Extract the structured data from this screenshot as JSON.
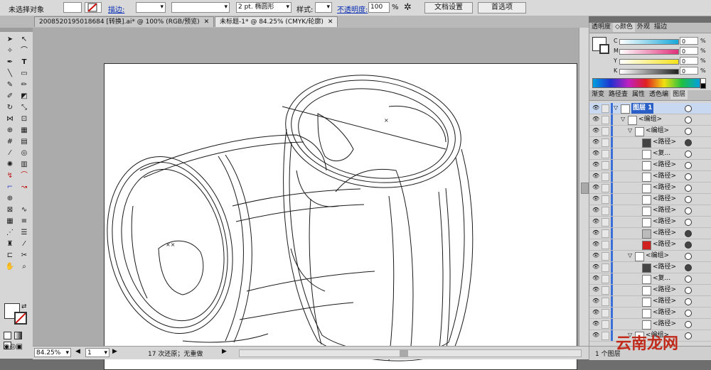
{
  "control_bar": {
    "selection_label": "未选择对象",
    "stroke_link": "描边:",
    "stroke_weight": "",
    "brush_value": "2 pt. 椭圆形",
    "style_label": "样式:",
    "opacity_link": "不透明度:",
    "opacity_value": "100",
    "opacity_unit": "%",
    "doc_setup_button": "文档设置",
    "prefs_button": "首选项"
  },
  "tabs": [
    {
      "label": "2008520195018684 [转换].ai* @ 100% (RGB/预览)",
      "active": false
    },
    {
      "label": "未标题-1* @ 84.25% (CMYK/轮廓)",
      "active": true
    }
  ],
  "status_bar": {
    "zoom": "84.25%",
    "page": "1",
    "history": "17 次还原；无重做"
  },
  "color_panel": {
    "tabs": [
      "透明度",
      "颜色",
      "外观",
      "描边"
    ],
    "active_tab": "颜色",
    "channels": [
      {
        "label": "C",
        "value": "0",
        "unit": "%",
        "color": "#19a7d9"
      },
      {
        "label": "M",
        "value": "0",
        "unit": "%",
        "color": "#e0307a"
      },
      {
        "label": "Y",
        "value": "0",
        "unit": "%",
        "color": "#f4e21c"
      },
      {
        "label": "K",
        "value": "0",
        "unit": "%",
        "color": "#222222"
      }
    ]
  },
  "layers_panel": {
    "tabs": [
      "渐变",
      "路径查",
      "属性",
      "透色编",
      "图层"
    ],
    "active_tab": "图层",
    "rows": [
      {
        "label": "图层 1",
        "indent": 0,
        "selected": true,
        "thumb": "layer"
      },
      {
        "label": "<编组>",
        "indent": 1,
        "selected": false,
        "thumb": "group"
      },
      {
        "label": "<编组>",
        "indent": 2,
        "selected": false,
        "thumb": "group"
      },
      {
        "label": "<路径>",
        "indent": 3,
        "selected": false,
        "thumb": "dark"
      },
      {
        "label": "<复...",
        "indent": 3,
        "selected": false,
        "thumb": "blank"
      },
      {
        "label": "<路径>",
        "indent": 3,
        "selected": false,
        "thumb": "blank"
      },
      {
        "label": "<路径>",
        "indent": 3,
        "selected": false,
        "thumb": "line"
      },
      {
        "label": "<路径>",
        "indent": 3,
        "selected": false,
        "thumb": "blank"
      },
      {
        "label": "<路径>",
        "indent": 3,
        "selected": false,
        "thumb": "blank"
      },
      {
        "label": "<路径>",
        "indent": 3,
        "selected": false,
        "thumb": "blank"
      },
      {
        "label": "<路径>",
        "indent": 3,
        "selected": false,
        "thumb": "blank"
      },
      {
        "label": "<路径>",
        "indent": 3,
        "selected": false,
        "thumb": "gray"
      },
      {
        "label": "<路径>",
        "indent": 3,
        "selected": false,
        "thumb": "red"
      },
      {
        "label": "<编组>",
        "indent": 2,
        "selected": false,
        "thumb": "group"
      },
      {
        "label": "<路径>",
        "indent": 3,
        "selected": false,
        "thumb": "dark"
      },
      {
        "label": "<复...",
        "indent": 3,
        "selected": false,
        "thumb": "blank"
      },
      {
        "label": "<路径>",
        "indent": 3,
        "selected": false,
        "thumb": "blank"
      },
      {
        "label": "<路径>",
        "indent": 3,
        "selected": false,
        "thumb": "blank"
      },
      {
        "label": "<路径>",
        "indent": 3,
        "selected": false,
        "thumb": "blank"
      },
      {
        "label": "<路径>",
        "indent": 3,
        "selected": false,
        "thumb": "blank"
      },
      {
        "label": "<编组>",
        "indent": 2,
        "selected": false,
        "thumb": "group"
      }
    ],
    "footer": "1 个图层"
  },
  "watermark": "云南龙网"
}
